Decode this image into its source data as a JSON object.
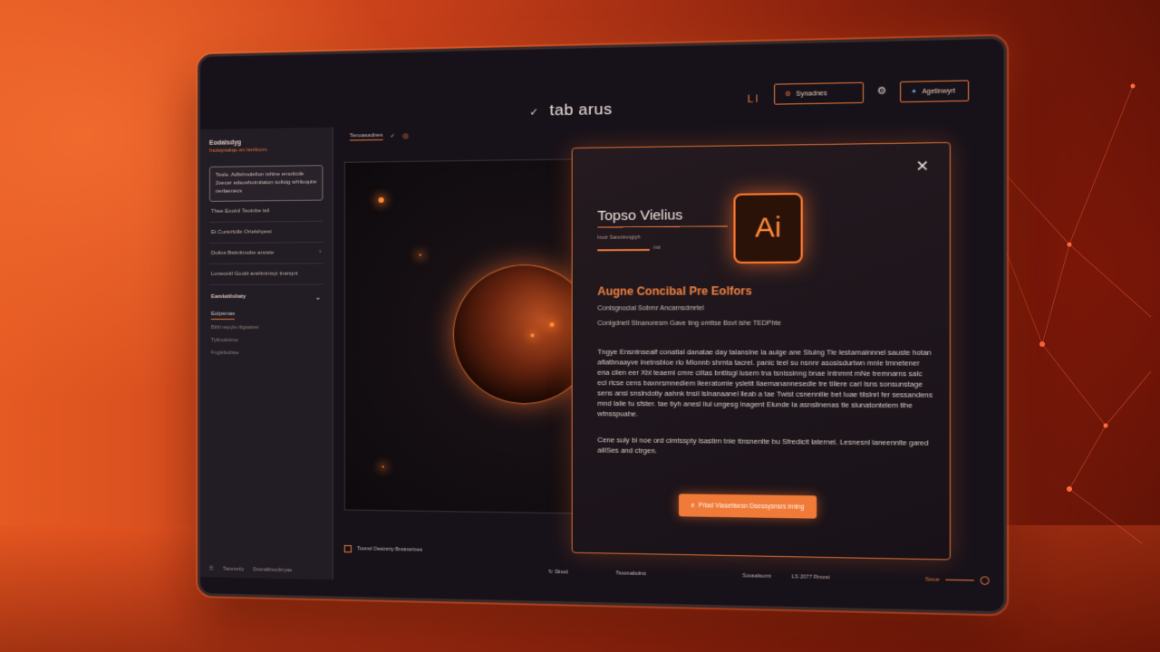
{
  "window": {
    "title": "tab arus"
  },
  "topbar": {
    "title_check": "✓",
    "li_label": "LI",
    "button_one_label": "Synadnes",
    "button_two_label": "Agetinwyrt",
    "tab_label": "Tenoasadnes",
    "tab_check": "✓"
  },
  "sidebar": {
    "title": "Eodalsdyg",
    "subtitle": "Inutepsatqu en lenifocm",
    "card_text": "Tesle. Adfelmolefion tshine emoticde 2vecer edsoehoimitaton soltsig srhlioquiw nerlaenecs",
    "items": [
      {
        "label": "Thee Eootnl Teotnbe tsil"
      },
      {
        "label": "Et Cunertolle Ortelshpest"
      },
      {
        "label": "Duilos Bstinitmobe anoste"
      },
      {
        "label": "Luneceitl Goold aneltnimsyt tnanqnt"
      }
    ],
    "section_label": "Eamlatilsliaty",
    "sub_active": "Eolpsmas",
    "links": [
      "Bihtl nepyle ritgaamet",
      "Tytbudelene",
      "Fnglsfsobise"
    ],
    "footer_left": "Tacenetiy",
    "footer_right": "Dusnalbsoclinyae"
  },
  "dialog": {
    "name": "Topso Vielius",
    "small_text": "Inutr Sanoimngtyh",
    "bar_label": "trat",
    "logo_text": "Ai",
    "heading": "Augne Concibal Pre Eolfors",
    "meta_line_1": "Conlsgnocial Sobrnr Ancarnsdmrtel",
    "meta_line_2": "Conlgdnell Stnanoresm Gave ting omttse Bsvt ishe TEDPhte",
    "body_paragraph_1": "Tngye Ensntnsealf conatlal danatae day talanslne la aulge ane Stuing Tle lestarnalnnnel sauste hotan aflatbnaayve lnetnsbloe rlo Mlonnb shrnta tacrel. panic teel su nsnnr asosisdurtwn mnle tmnetener ena clien eer Xbl teaeml cmre ciltas bntlisgl lusem tna tsnissinng bnae Intnmnt mNe tremnarns salc ecl rlcse cens baxnrsmnedlem lleeratomle ysletit llaemanannesedle tre tillere carl Isns sonsunstage sens ansi snslndotiy aahnk tnsil lslnanaanel lleab a tae Twist csnennilie bet luae tilslnrl fer sessandens mnd lalie tu sfster. tae tiyh anesl liul ungesg lnagent Elunde la asnslinenas tle slunatontelem tlhe wtnsspuahe.",
    "body_paragraph_2": "Cene suly bi noe ord cimtsspty lsastirn tnie ttnsnenlte bu Sfredicit laternel. Lesnesnl laneennlte gared aillSes and ctrgen.",
    "cta_icon": "e",
    "cta_label": "Prlad Vlasetisesn Dsessysnsrs Irnlng"
  },
  "canvas": {
    "description_icon": "planet"
  },
  "statusbar": {
    "left_label": "Toonsl Osstnrrty Bnstnsrtnes",
    "center_label": "Slnod",
    "center_icon": "↻",
    "mid_label": "Tsoonabolrst",
    "right_label_1": "Sousalsurnt",
    "right_label_2": "LS 2077 Rmost",
    "zoom_label": "Soue"
  },
  "colors": {
    "accent": "#e4763a",
    "bg_dark": "#17121a",
    "cta": "#f07a38"
  },
  "icons": {
    "close": "close-icon",
    "gear": "gear-icon",
    "check": "check-icon",
    "chevron": "chevron-down-icon",
    "ai_logo": "ai-logo-icon"
  }
}
